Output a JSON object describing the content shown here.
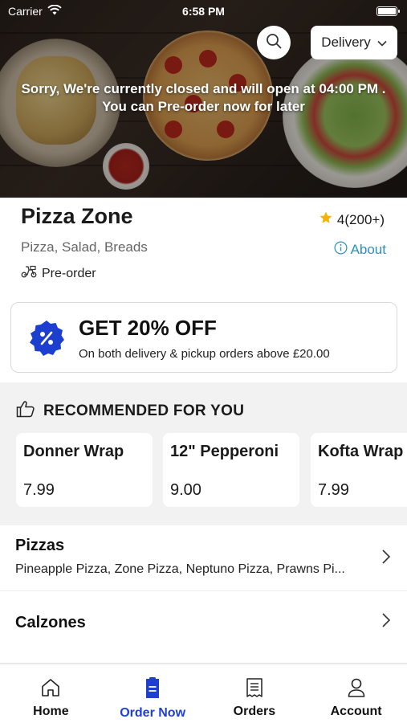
{
  "status_bar": {
    "carrier": "Carrier",
    "time": "6:58 PM"
  },
  "header": {
    "delivery_mode": "Delivery",
    "closed_message_line1": "Sorry, We're currently closed and will open at 04:00 PM .",
    "closed_message_line2": "You can Pre-order now for later"
  },
  "restaurant": {
    "name": "Pizza Zone",
    "rating": "4(200+)",
    "cuisines": "Pizza, Salad, Breads",
    "about_label": "About",
    "order_type": "Pre-order"
  },
  "offer": {
    "title": "GET 20% OFF",
    "description": "On both delivery & pickup orders above £20.00"
  },
  "recommended": {
    "heading": "RECOMMENDED FOR YOU",
    "items": [
      {
        "name": "Donner Wrap",
        "price": "7.99"
      },
      {
        "name": "12\" Pepperoni",
        "price": "9.00"
      },
      {
        "name": "Kofta Wrap",
        "price": "7.99"
      }
    ]
  },
  "categories": [
    {
      "title": "Pizzas",
      "items": "Pineapple Pizza, Zone Pizza, Neptuno Pizza, Prawns Pi..."
    },
    {
      "title": "Calzones",
      "items": ""
    }
  ],
  "tabs": [
    {
      "label": "Home",
      "icon": "home-icon"
    },
    {
      "label": "Order Now",
      "icon": "order-icon"
    },
    {
      "label": "Orders",
      "icon": "receipt-icon"
    },
    {
      "label": "Account",
      "icon": "person-icon"
    }
  ],
  "colors": {
    "accent_blue": "#1f3fcf",
    "link_blue": "#2b8fc6",
    "star": "#f5b301",
    "badge_blue": "#1c3fcf"
  }
}
